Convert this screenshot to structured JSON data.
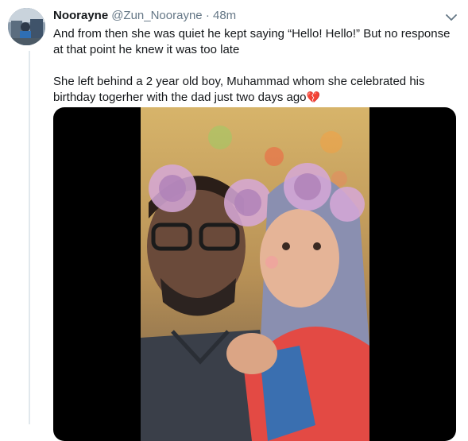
{
  "tweet": {
    "author_name": "Noorayne",
    "author_handle": "@Zun_Noorayne",
    "separator": "·",
    "timestamp": "48m",
    "paragraphs": [
      "And from then she was quiet he kept saying “Hello! Hello!” But no response at that point he knew it was too late",
      "She left behind a 2 year old boy, Muhammad whom she celebrated his birthday togerher with the dad just two days ago"
    ],
    "emoji": "💔"
  },
  "icons": {
    "menu": "chevron-down-icon",
    "emoji": "broken-heart-emoji"
  },
  "colors": {
    "text": "#14171a",
    "secondary": "#657786",
    "thread_line": "#e1e8ed",
    "media_bg": "#000000"
  }
}
